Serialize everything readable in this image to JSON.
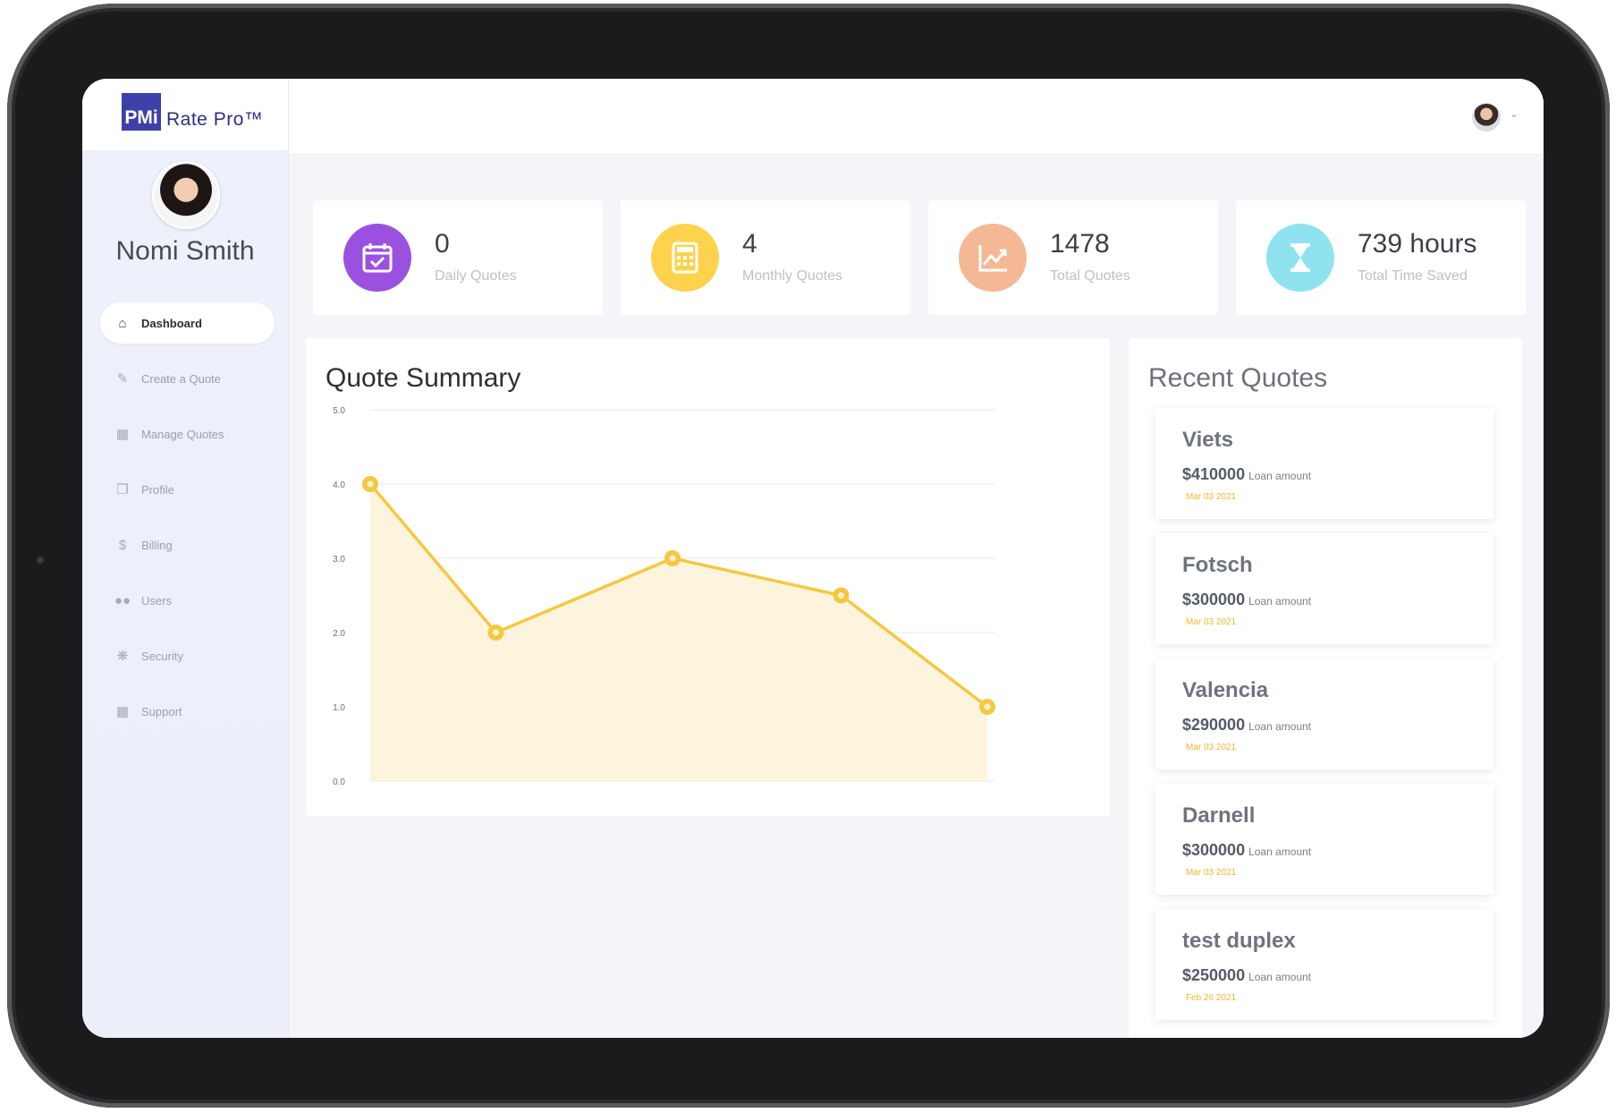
{
  "brand": {
    "logo_mark": "PMi",
    "logo_text": "Rate Pro™"
  },
  "user": {
    "name": "Nomi Smith"
  },
  "nav": [
    {
      "label": "Dashboard",
      "icon": "home-icon",
      "active": true
    },
    {
      "label": "Create a Quote",
      "icon": "edit-icon",
      "active": false
    },
    {
      "label": "Manage Quotes",
      "icon": "table-icon",
      "active": false
    },
    {
      "label": "Profile",
      "icon": "copy-icon",
      "active": false
    },
    {
      "label": "Billing",
      "icon": "dollar-icon",
      "active": false
    },
    {
      "label": "Users",
      "icon": "users-icon",
      "active": false
    },
    {
      "label": "Security",
      "icon": "bug-icon",
      "active": false
    },
    {
      "label": "Support",
      "icon": "windows-icon",
      "active": false
    }
  ],
  "stats": [
    {
      "value": "0",
      "label": "Daily Quotes",
      "icon": "calendar-check-icon",
      "color": "#9b51e0"
    },
    {
      "value": "4",
      "label": "Monthly Quotes",
      "icon": "calculator-icon",
      "color": "#ffd24d"
    },
    {
      "value": "1478",
      "label": "Total Quotes",
      "icon": "chart-line-icon",
      "color": "#f5b895"
    },
    {
      "value": "739 hours",
      "label": "Total Time Saved",
      "icon": "hourglass-icon",
      "color": "#8ee3ef"
    }
  ],
  "summary": {
    "title": "Quote Summary"
  },
  "chart_data": {
    "type": "area",
    "title": "Quote Summary",
    "y_ticks": [
      "5.0",
      "4.0",
      "3.0",
      "2.0",
      "1.0",
      "0.0"
    ],
    "ylim": [
      0,
      5
    ],
    "series": [
      {
        "values": [
          4.0,
          2.0,
          3.0,
          2.5,
          1.0
        ]
      }
    ],
    "grid": true,
    "line_color": "#f5c842",
    "fill_color": "#fdf3d9"
  },
  "recent": {
    "title": "Recent Quotes",
    "amount_label": "Loan amount",
    "items": [
      {
        "name": "Viets",
        "amount": "$410000",
        "date": "Mar 03 2021"
      },
      {
        "name": "Fotsch",
        "amount": "$300000",
        "date": "Mar 03 2021"
      },
      {
        "name": "Valencia",
        "amount": "$290000",
        "date": "Mar 03 2021"
      },
      {
        "name": "Darnell",
        "amount": "$300000",
        "date": "Mar 03 2021"
      },
      {
        "name": "test duplex",
        "amount": "$250000",
        "date": "Feb 26 2021"
      }
    ]
  }
}
